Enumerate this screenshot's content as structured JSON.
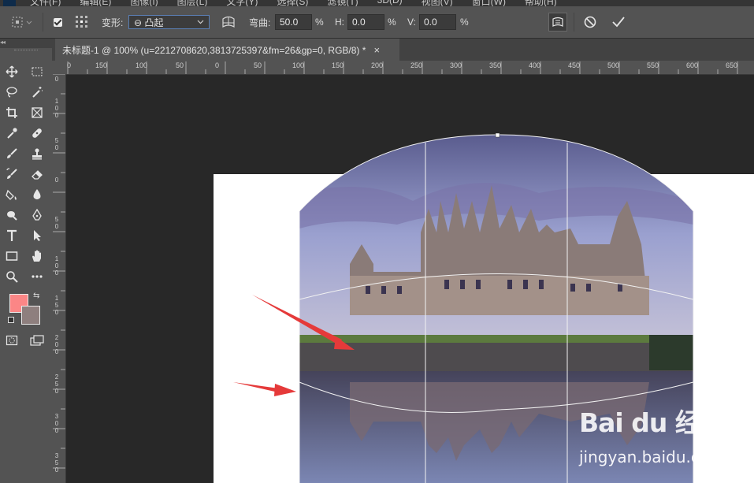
{
  "menubar": {
    "items": [
      "文件(F)",
      "编辑(E)",
      "图像(I)",
      "图层(L)",
      "文字(Y)",
      "选择(S)",
      "滤镜(T)",
      "3D(D)",
      "视图(V)",
      "窗口(W)",
      "帮助(H)"
    ]
  },
  "options": {
    "warp_label": "变形:",
    "warp_value": "⊖ 凸起",
    "bend_label": "弯曲:",
    "bend_value": "50.0",
    "bend_unit": "%",
    "h_label": "H:",
    "h_value": "0.0",
    "h_unit": "%",
    "v_label": "V:",
    "v_value": "0.0",
    "v_unit": "%"
  },
  "document": {
    "tab_title": "未标题-1 @ 100% (u=2212708620,3813725397&fm=26&gp=0, RGB/8) *",
    "close_glyph": "×"
  },
  "collapse_glyph": "◂◂",
  "ruler": {
    "top_labels": [
      "0",
      "150",
      "100",
      "50",
      "0",
      "50",
      "100",
      "150",
      "200",
      "250",
      "300",
      "350",
      "400",
      "450",
      "500",
      "550",
      "600",
      "650"
    ],
    "left_labels": [
      "0",
      "1 0 0",
      "5 0",
      "0",
      "5 0",
      "1 0 0",
      "1 5 0",
      "2 0 0",
      "2 5 0",
      "3 0 0",
      "3 5 0"
    ]
  },
  "colors": {
    "foreground": "#fb8686",
    "background": "#8e7f7e"
  },
  "watermark": {
    "brand": "Bai du 经验",
    "url": "jingyan.baidu.com"
  }
}
